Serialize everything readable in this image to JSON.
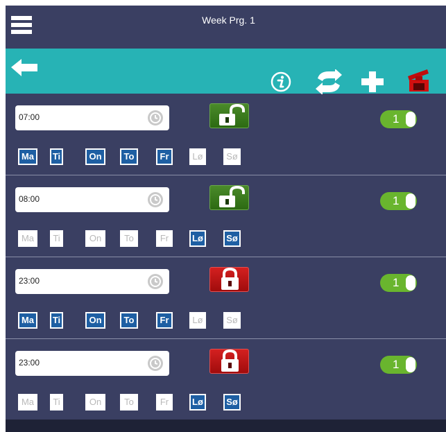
{
  "header": {
    "title": "Week Prg. 1"
  },
  "toolbar": {
    "icons": [
      "back-arrow-icon",
      "info-icon",
      "sync-icon",
      "add-icon",
      "delete-icon"
    ]
  },
  "colors": {
    "background": "#3a3f62",
    "toolbar": "#27b3b5",
    "day_selected": "#1e5fa3",
    "toggle_on": "#69b52e",
    "lock_open": "#2c6a12",
    "lock_closed": "#a00c0c"
  },
  "schedule": [
    {
      "time": "07:00",
      "lock": "unlocked",
      "toggle_label": "1",
      "days": [
        {
          "label": "Ma",
          "selected": true
        },
        {
          "label": "Ti",
          "selected": true
        },
        {
          "label": "On",
          "selected": true
        },
        {
          "label": "To",
          "selected": true
        },
        {
          "label": "Fr",
          "selected": true
        },
        {
          "label": "Lø",
          "selected": false
        },
        {
          "label": "Sø",
          "selected": false
        }
      ]
    },
    {
      "time": "08:00",
      "lock": "unlocked",
      "toggle_label": "1",
      "days": [
        {
          "label": "Ma",
          "selected": false
        },
        {
          "label": "Ti",
          "selected": false
        },
        {
          "label": "On",
          "selected": false
        },
        {
          "label": "To",
          "selected": false
        },
        {
          "label": "Fr",
          "selected": false
        },
        {
          "label": "Lø",
          "selected": true
        },
        {
          "label": "Sø",
          "selected": true
        }
      ]
    },
    {
      "time": "23:00",
      "lock": "locked",
      "toggle_label": "1",
      "days": [
        {
          "label": "Ma",
          "selected": true
        },
        {
          "label": "Ti",
          "selected": true
        },
        {
          "label": "On",
          "selected": true
        },
        {
          "label": "To",
          "selected": true
        },
        {
          "label": "Fr",
          "selected": true
        },
        {
          "label": "Lø",
          "selected": false
        },
        {
          "label": "Sø",
          "selected": false
        }
      ]
    },
    {
      "time": "23:00",
      "lock": "locked",
      "toggle_label": "1",
      "days": [
        {
          "label": "Ma",
          "selected": false
        },
        {
          "label": "Ti",
          "selected": false
        },
        {
          "label": "On",
          "selected": false
        },
        {
          "label": "To",
          "selected": false
        },
        {
          "label": "Fr",
          "selected": false
        },
        {
          "label": "Lø",
          "selected": true
        },
        {
          "label": "Sø",
          "selected": true
        }
      ]
    }
  ]
}
